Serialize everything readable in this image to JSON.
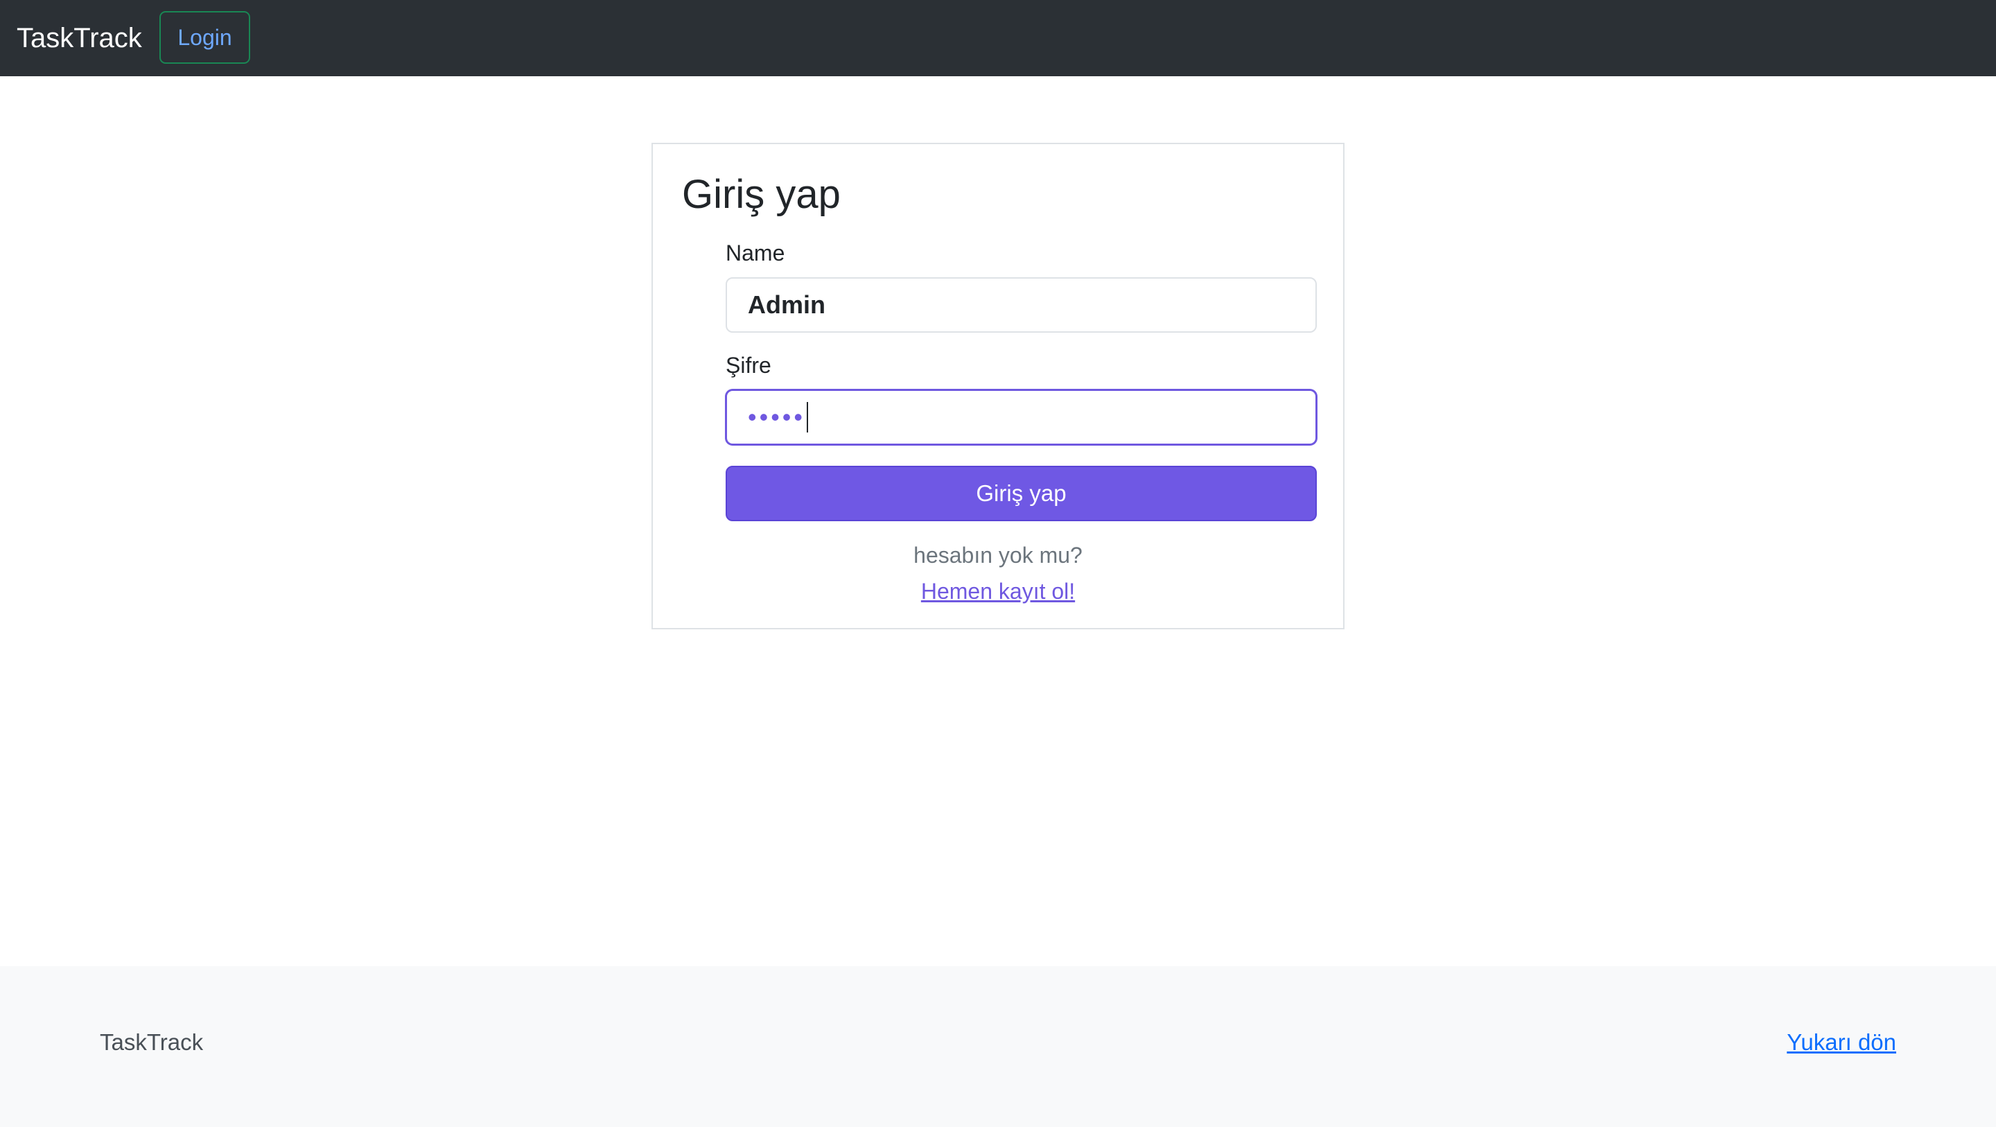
{
  "navbar": {
    "brand": "TaskTrack",
    "login_label": "Login"
  },
  "login_card": {
    "title": "Giriş yap",
    "name_label": "Name",
    "name_value": "Admin",
    "password_label": "Şifre",
    "password_mask": "•••••",
    "submit_label": "Giriş yap",
    "no_account_text": "hesabın yok mu?",
    "register_link": "Hemen kayıt ol!"
  },
  "footer": {
    "brand": "TaskTrack",
    "back_to_top": "Yukarı dön"
  },
  "colors": {
    "navbar_bg": "#2b3035",
    "accent": "#6f58e4",
    "login_border": "#198754",
    "link_blue": "#0d6efd"
  }
}
